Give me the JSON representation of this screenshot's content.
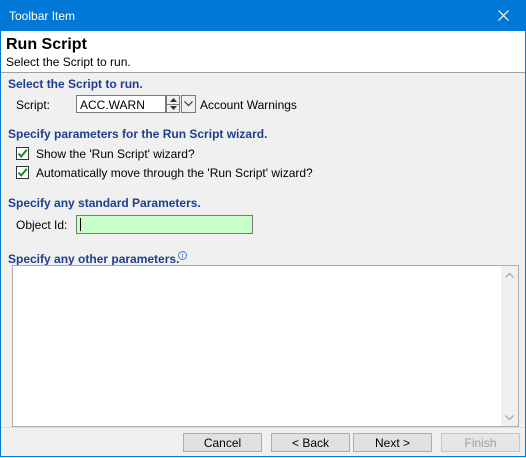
{
  "window": {
    "title": "Toolbar Item"
  },
  "header": {
    "title": "Run Script",
    "subtitle": "Select the Script to run."
  },
  "script_section": {
    "heading": "Select the Script to run.",
    "label": "Script:",
    "value": "ACC.WARN",
    "description": "Account Warnings"
  },
  "params_section": {
    "heading": "Specify parameters for the Run Script wizard.",
    "options": [
      {
        "label": "Show the 'Run Script' wizard?",
        "checked": true
      },
      {
        "label": "Automatically move through the 'Run Script' wizard?",
        "checked": true
      }
    ]
  },
  "standard_section": {
    "heading": "Specify any standard Parameters.",
    "object_id_label": "Object Id:",
    "object_id_value": ""
  },
  "other_section": {
    "heading": "Specify any other parameters.",
    "info_icon": "info-icon",
    "value": ""
  },
  "buttons": {
    "cancel": "Cancel",
    "back": "< Back",
    "next": "Next >",
    "finish": "Finish"
  }
}
